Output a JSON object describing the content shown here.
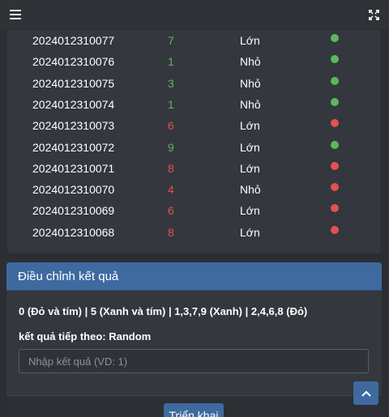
{
  "topbar": {
    "menu_icon": "hamburger-menu-icon",
    "fullscreen_icon": "fullscreen-expand-icon"
  },
  "results": [
    {
      "id": "2024012310077",
      "number": "7",
      "size": "Lớn",
      "color": "green"
    },
    {
      "id": "2024012310076",
      "number": "1",
      "size": "Nhỏ",
      "color": "green"
    },
    {
      "id": "2024012310075",
      "number": "3",
      "size": "Nhỏ",
      "color": "green"
    },
    {
      "id": "2024012310074",
      "number": "1",
      "size": "Nhỏ",
      "color": "green"
    },
    {
      "id": "2024012310073",
      "number": "6",
      "size": "Lớn",
      "color": "red"
    },
    {
      "id": "2024012310072",
      "number": "9",
      "size": "Lớn",
      "color": "green"
    },
    {
      "id": "2024012310071",
      "number": "8",
      "size": "Lớn",
      "color": "red"
    },
    {
      "id": "2024012310070",
      "number": "4",
      "size": "Nhỏ",
      "color": "red"
    },
    {
      "id": "2024012310069",
      "number": "6",
      "size": "Lớn",
      "color": "red"
    },
    {
      "id": "2024012310068",
      "number": "8",
      "size": "Lớn",
      "color": "red"
    }
  ],
  "adjust": {
    "title": "Điều chỉnh kết quả",
    "legend": "0 (Đỏ và tím) | 5 (Xanh và tím) | 1,3,7,9 (Xanh) | 2,4,6,8 (Đỏ)",
    "next_result": "kết quả tiếp theo: Random",
    "input_placeholder": "Nhập kết quả (VD: 1)",
    "input_value": "",
    "deploy_label": "Triển khai"
  },
  "colors": {
    "green": "#5cb85c",
    "red": "#e0534e",
    "accent": "#3e6aa0"
  },
  "scroll_top_icon": "chevron-up-icon"
}
